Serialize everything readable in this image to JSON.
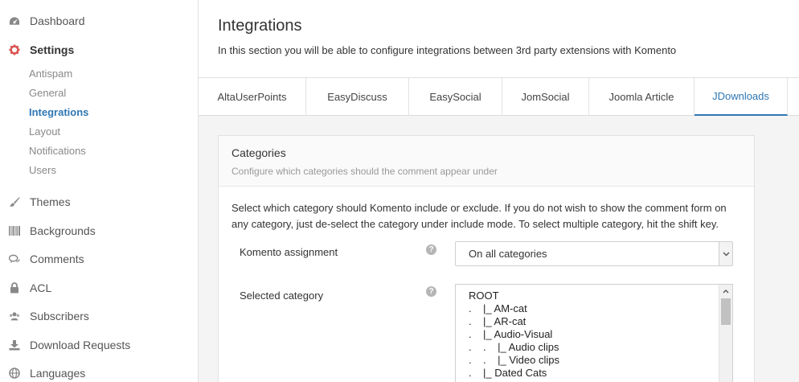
{
  "sidebar": {
    "items": [
      {
        "label": "Dashboard",
        "icon": "dashboard-icon"
      },
      {
        "label": "Settings",
        "icon": "gear-icon"
      },
      {
        "label": "Themes",
        "icon": "brush-icon"
      },
      {
        "label": "Backgrounds",
        "icon": "barcode-icon"
      },
      {
        "label": "Comments",
        "icon": "comments-icon"
      },
      {
        "label": "ACL",
        "icon": "lock-icon"
      },
      {
        "label": "Subscribers",
        "icon": "users-icon"
      },
      {
        "label": "Download Requests",
        "icon": "download-icon"
      },
      {
        "label": "Languages",
        "icon": "globe-icon"
      }
    ],
    "settings_sub": [
      "Antispam",
      "General",
      "Integrations",
      "Layout",
      "Notifications",
      "Users"
    ]
  },
  "header": {
    "title": "Integrations",
    "description": "In this section you will be able to configure integrations between 3rd party extensions with Komento"
  },
  "tabs": [
    "AltaUserPoints",
    "EasyDiscuss",
    "EasySocial",
    "JomSocial",
    "Joomla Article",
    "JDownloads"
  ],
  "panel": {
    "title": "Categories",
    "subtitle": "Configure which categories should the comment appear under",
    "text": "Select which category should Komento include or exclude. If you do not wish to show the comment form on any category, just de-select the category under include mode. To select multiple category, hit the shift key.",
    "assignment_label": "Komento assignment",
    "assignment_value": "On all categories",
    "selected_label": "Selected category",
    "help_glyph": "?",
    "categories": [
      "ROOT",
      ".    |_ AM-cat",
      ".    |_ AR-cat",
      ".    |_ Audio-Visual",
      ".    .    |_ Audio clips",
      ".    .    |_ Video clips",
      ".    |_ Dated Cats"
    ]
  },
  "colors": {
    "accent": "#2f77b4",
    "settings_icon": "#d9534f"
  }
}
